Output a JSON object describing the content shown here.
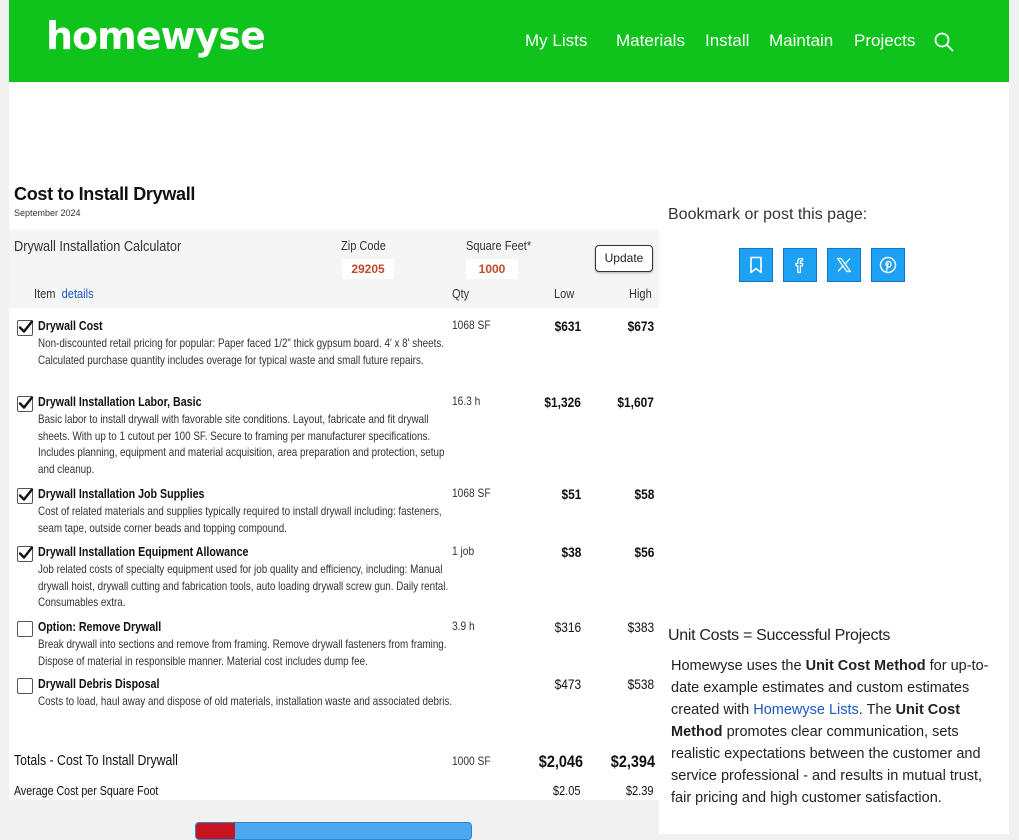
{
  "site": {
    "logo": "homewyse",
    "nav": [
      "My Lists",
      "Materials",
      "Install",
      "Maintain",
      "Projects"
    ]
  },
  "page": {
    "title": "Cost to Install Drywall",
    "date": "September 2024"
  },
  "calculator": {
    "title": "Drywall Installation Calculator",
    "zip_label": "Zip Code",
    "zip_value": "29205",
    "sqft_label": "Square Feet*",
    "sqft_value": "1000",
    "update_label": "Update",
    "headers": {
      "item": "Item",
      "details": "details",
      "qty": "Qty",
      "low": "Low",
      "high": "High"
    },
    "items": [
      {
        "checked": true,
        "title": "Drywall Cost",
        "desc": "Non-discounted retail pricing for popular: Paper faced 1/2\" thick gypsum board. 4' x 8' sheets. Calculated purchase quantity includes overage for typical waste and small future repairs.",
        "qty": "1068 SF",
        "low": "$631",
        "high": "$673"
      },
      {
        "checked": true,
        "title": "Drywall Installation Labor, Basic",
        "desc": "Basic labor to install drywall with favorable site conditions. Layout, fabricate and fit drywall sheets. With up to 1 cutout per 100 SF. Secure to framing per manufacturer specifications. Includes planning, equipment and material acquisition, area preparation and protection, setup and cleanup.",
        "qty": "16.3 h",
        "low": "$1,326",
        "high": "$1,607"
      },
      {
        "checked": true,
        "title": "Drywall Installation Job Supplies",
        "desc": "Cost of related materials and supplies typically required to install drywall including: fasteners, seam tape, outside corner beads and topping compound.",
        "qty": "1068 SF",
        "low": "$51",
        "high": "$58"
      },
      {
        "checked": true,
        "title": "Drywall Installation Equipment Allowance",
        "desc": "Job related costs of specialty equipment used for job quality and efficiency, including: Manual drywall hoist, drywall cutting and fabrication tools, auto loading drywall screw gun. Daily rental. Consumables extra.",
        "qty": "1 job",
        "low": "$38",
        "high": "$56"
      },
      {
        "checked": false,
        "title": "Option: Remove Drywall",
        "desc": "Break drywall into sections and remove from framing. Remove drywall fasteners from framing. Dispose of material in responsible manner. Material cost includes dump fee.",
        "qty": "3.9 h",
        "low": "$316",
        "high": "$383"
      },
      {
        "checked": false,
        "title": "Drywall Debris Disposal",
        "desc": "Costs to load, haul away and dispose of old materials, installation waste and associated debris.",
        "qty": "",
        "low": "$473",
        "high": "$538"
      }
    ],
    "totals": {
      "label": "Totals - Cost To Install Drywall",
      "qty": "1000 SF",
      "low": "$2,046",
      "high": "$2,394"
    },
    "average": {
      "label": "Average Cost per Square Foot",
      "low": "$2.05",
      "high": "$2.39"
    },
    "progress": 0.14
  },
  "sidebar": {
    "bookmark_title": "Bookmark or post this page:",
    "share_icons": [
      "bookmark-icon",
      "facebook-icon",
      "x-icon",
      "pinterest-icon"
    ],
    "unit_cost_title": "Unit Costs = Successful Projects",
    "unit_cost_parts": [
      {
        "t": "Homewyse uses the ",
        "s": "n"
      },
      {
        "t": "Unit Cost Method",
        "s": "b"
      },
      {
        "t": " for up-to-date example estimates and custom estimates created with ",
        "s": "n"
      },
      {
        "t": "Homewyse Lists",
        "s": "a"
      },
      {
        "t": ". The ",
        "s": "n"
      },
      {
        "t": "Unit Cost Method",
        "s": "b"
      },
      {
        "t": " promotes clear communication, sets realistic expectations between the customer and service professional - and results in mutual trust, fair pricing and high customer satisfaction.",
        "s": "n"
      }
    ]
  },
  "colors": {
    "brand_green": "#0ec31c",
    "accent_red": "#c0492a",
    "share_blue": "#1da1f2",
    "link_blue": "#1a56c4"
  }
}
